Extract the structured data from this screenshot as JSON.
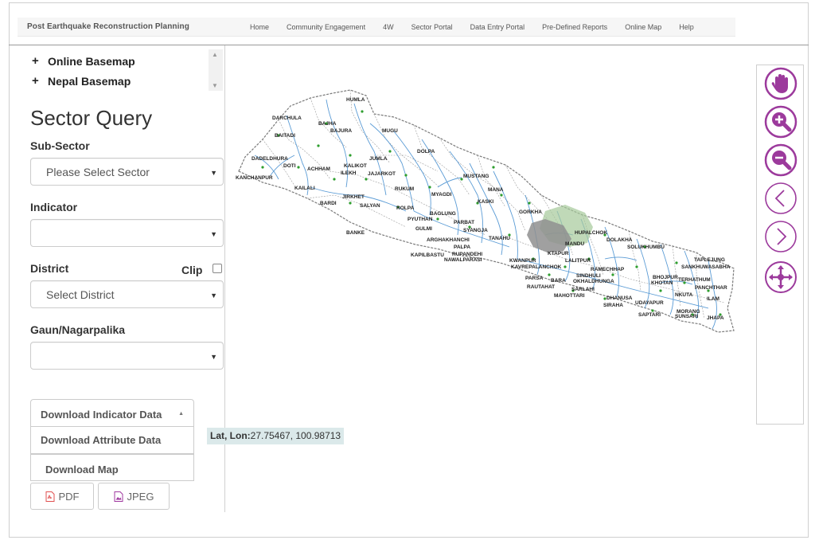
{
  "header": {
    "brand": "Post Earthquake Reconstruction Planning",
    "nav": [
      "Home",
      "Community Engagement",
      "4W",
      "Sector Portal",
      "Data Entry Portal",
      "Pre-Defined Reports",
      "Online Map",
      "Help"
    ]
  },
  "layers": {
    "items": [
      {
        "label": "Online Basemap"
      },
      {
        "label": "Nepal Basemap"
      }
    ]
  },
  "sector_query": {
    "title": "Sector Query",
    "sub_sector_label": "Sub-Sector",
    "sub_sector_value": "Please Select Sector",
    "indicator_label": "Indicator",
    "indicator_value": "",
    "district_label": "District",
    "clip_label": "Clip",
    "district_value": "Select District",
    "gaun_label": "Gaun/Nagarpalika",
    "gaun_value": ""
  },
  "downloads": {
    "indicator": "Download Indicator Data",
    "attribute": "Download Attribute Data",
    "map": "Download Map",
    "pdf": "PDF",
    "jpeg": "JPEG"
  },
  "coordinates": {
    "label": "Lat, Lon:",
    "value": "27.75467, 100.98713"
  },
  "map_labels": [
    "HUMLA",
    "DARCHULA",
    "BAJHA",
    "BAJURA",
    "BAITADI",
    "MUGU",
    "DOLPA",
    "DADELDHURA",
    "DOTI",
    "ACHHAM",
    "KALIKOT",
    "JUMLA",
    "ILEKH",
    "JAJARKOT",
    "MUSTANG",
    "KANCHANPUR",
    "KAILALI",
    "RUKUM",
    "MYAGDI",
    "MANA",
    "BARDI",
    "JIRKHET",
    "SALYAN",
    "ROLPA",
    "KASKI",
    "BAGLUNG",
    "PYUTHAN",
    "PARBAT",
    "GORKHA",
    "GULMI",
    "SYANGJA",
    "TANAHU",
    "BANKE",
    "ARGHAKHANCHI",
    "PALPA",
    "KAPILBASTU",
    "RUPANDEHI",
    "NAWALPARASI",
    "HUPALCHOK",
    "DOLAKHA",
    "SOLUKHUMBU",
    "MANDU",
    "KTAPUR",
    "LALITPUR",
    "KWANPUR",
    "KAVREPALANCHOK",
    "RAMECHHAP",
    "TAPLEJUNG",
    "SANKHUWASABHA",
    "SINDHULI",
    "BHOJPUR",
    "KHOTAN",
    "TERHATHUM",
    "PANCHTHAR",
    "PARSA",
    "BARA",
    "OKHALDHUNGA",
    "RAUTAHAT",
    "SARLAHI",
    "MAHOTTARI",
    "DHANUSA",
    "SIRAHA",
    "UDAYAPUR",
    "NKUTA",
    "ILAM",
    "MORANG",
    "SAPTARI",
    "SUNSARI",
    "JHAPA"
  ],
  "tools": [
    "pan-icon",
    "zoom-in-icon",
    "zoom-out-icon",
    "previous-extent-icon",
    "next-extent-icon",
    "full-extent-icon"
  ],
  "colors": {
    "tool_accent": "#9c3a9c",
    "river": "#5a9bd5",
    "highlight": "#a5c99a",
    "coord_bg": "#dbe9ea"
  }
}
